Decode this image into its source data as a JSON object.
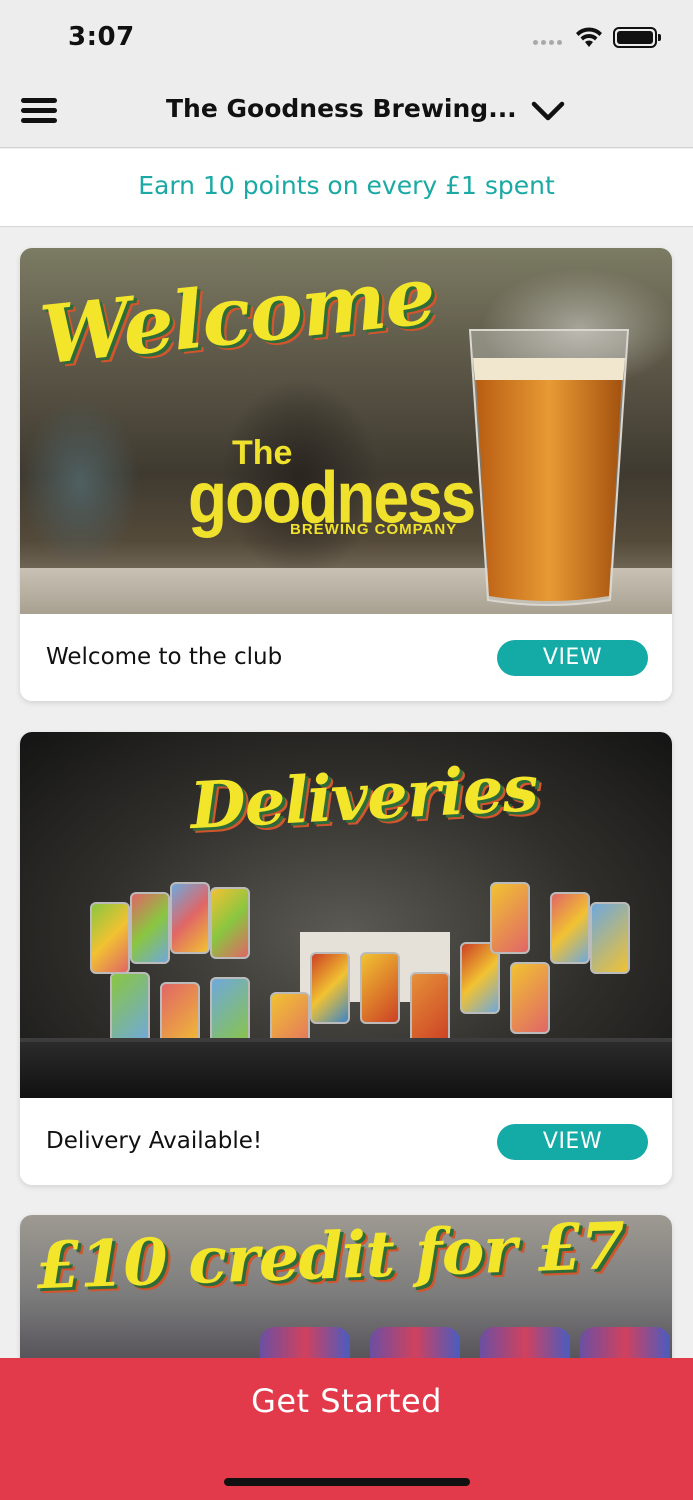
{
  "status_bar": {
    "time": "3:07"
  },
  "header": {
    "title": "The Goodness Brewing...",
    "menu_icon": "hamburger-menu-icon",
    "dropdown_icon": "chevron-down-icon"
  },
  "banner": {
    "text": "Earn 10 points on every £1 spent"
  },
  "cards": [
    {
      "image_title": "Welcome",
      "brand_small": "The",
      "brand_large": "goodness",
      "brand_sub": "BREWING COMPANY",
      "label": "Welcome to the club",
      "button": "VIEW"
    },
    {
      "image_title": "Deliveries",
      "label": "Delivery Available!",
      "button": "VIEW"
    },
    {
      "image_title": "£10 credit for £7"
    }
  ],
  "cta": {
    "label": "Get Started"
  },
  "colors": {
    "accent_teal": "#14aaa6",
    "cta_red": "#e23a4a",
    "script_yellow": "#f2e52a"
  }
}
